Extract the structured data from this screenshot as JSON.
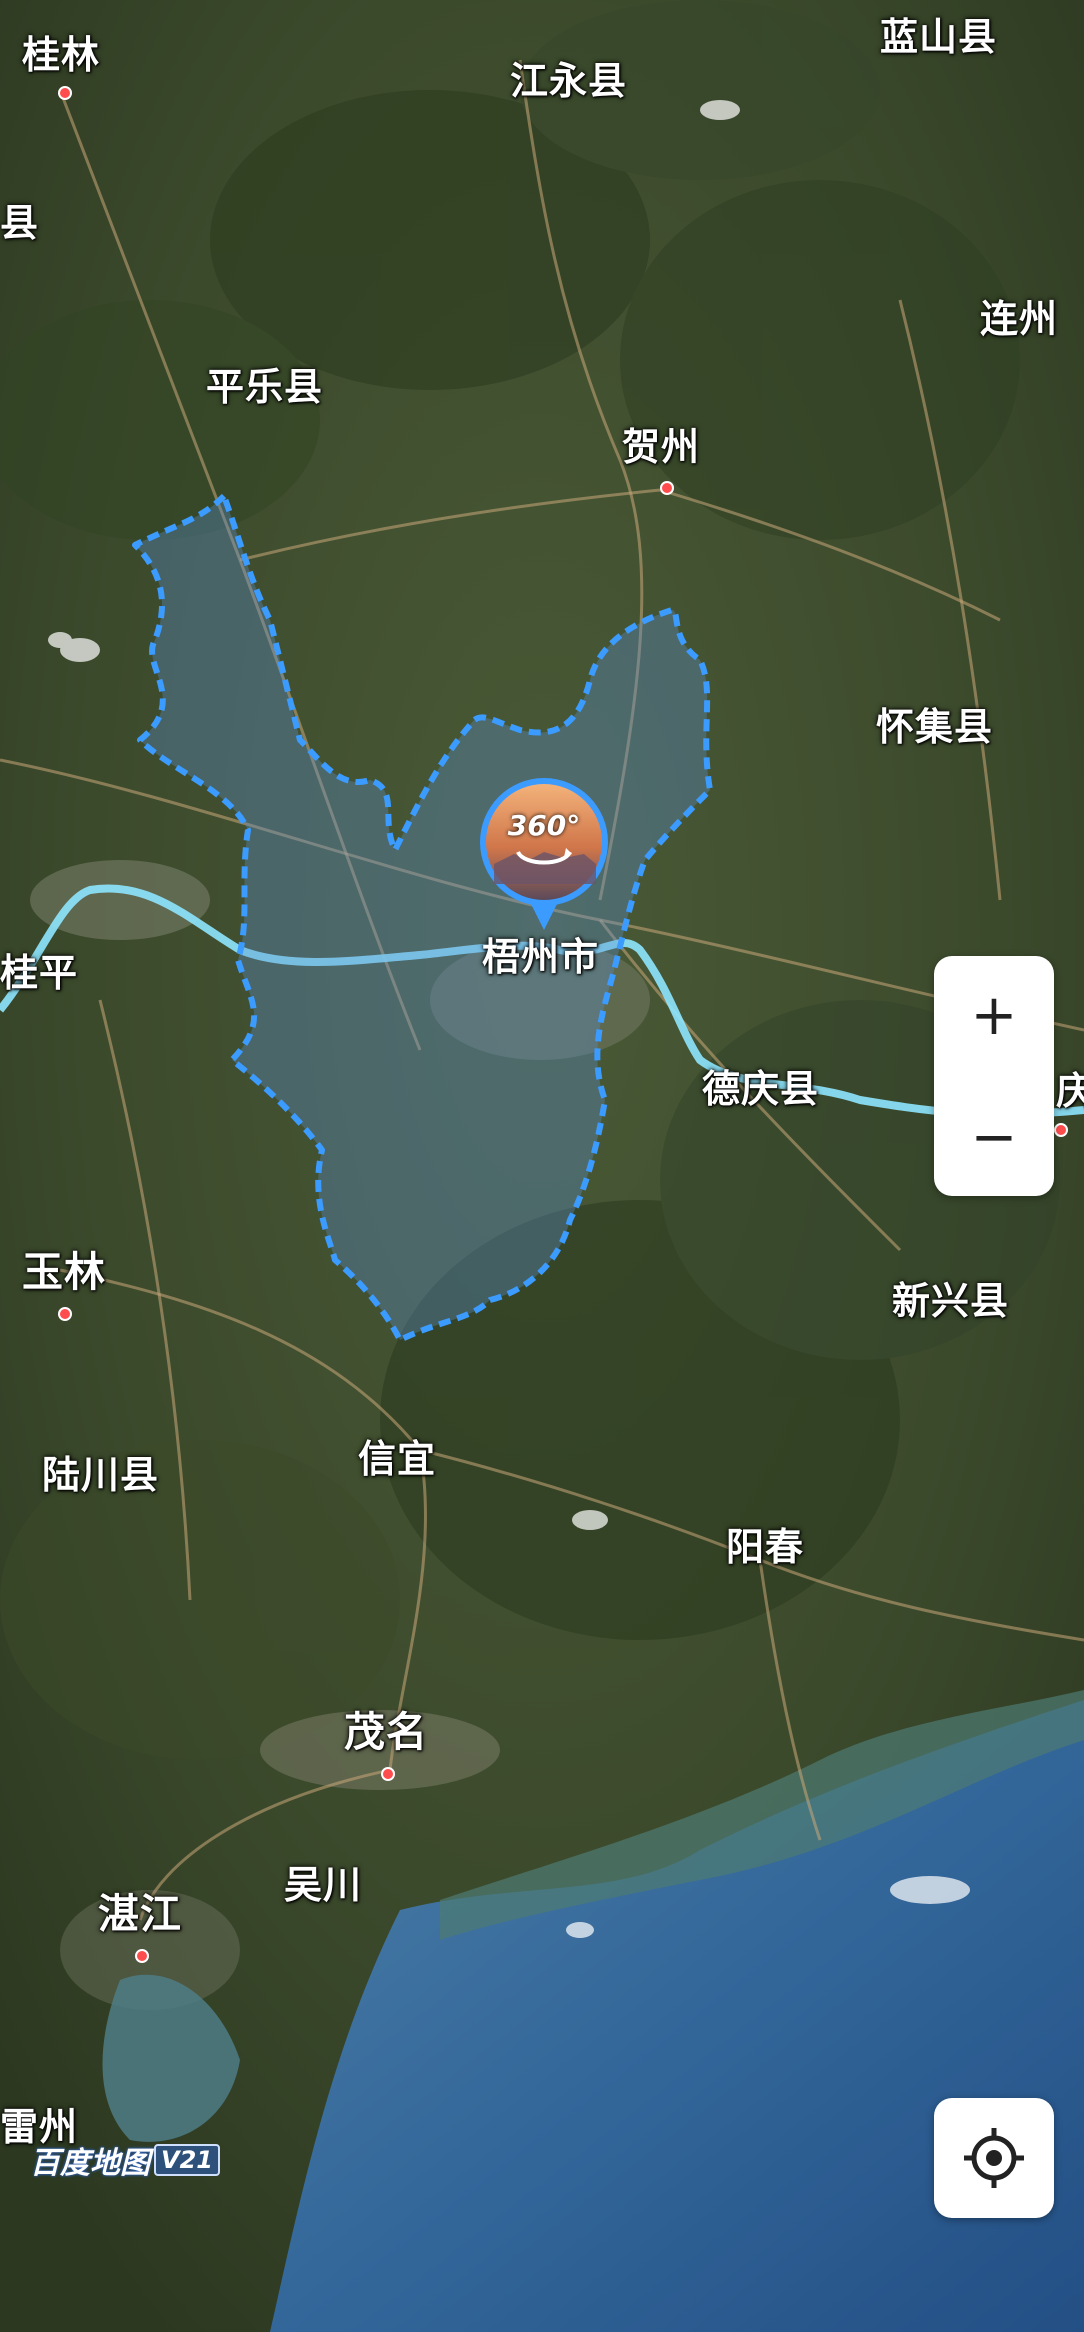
{
  "map": {
    "cities": [
      {
        "id": "guilin",
        "name": "桂林",
        "capital": true
      },
      {
        "id": "jiangyong",
        "name": "江永县",
        "capital": false
      },
      {
        "id": "lanshan",
        "name": "蓝山县",
        "capital": false
      },
      {
        "id": "xian-edge",
        "name": "县",
        "capital": false
      },
      {
        "id": "lianzhou",
        "name": "连州",
        "capital": false
      },
      {
        "id": "pingle",
        "name": "平乐县",
        "capital": false
      },
      {
        "id": "hezhou",
        "name": "贺州",
        "capital": true
      },
      {
        "id": "huaiji",
        "name": "怀集县",
        "capital": false
      },
      {
        "id": "wuzhou",
        "name": "梧州市",
        "capital": false,
        "highlighted": true
      },
      {
        "id": "guiping",
        "name": "桂平",
        "capital": false
      },
      {
        "id": "deqing",
        "name": "德庆县",
        "capital": false
      },
      {
        "id": "zhaoqing-edge",
        "name": "庆",
        "capital": true
      },
      {
        "id": "yulin",
        "name": "玉林",
        "capital": true
      },
      {
        "id": "xinxing",
        "name": "新兴县",
        "capital": false
      },
      {
        "id": "luchuan",
        "name": "陆川县",
        "capital": false
      },
      {
        "id": "xinyi",
        "name": "信宜",
        "capital": false
      },
      {
        "id": "yangchun",
        "name": "阳春",
        "capital": false
      },
      {
        "id": "maoming",
        "name": "茂名",
        "capital": true
      },
      {
        "id": "wuchuan",
        "name": "吴川",
        "capital": false
      },
      {
        "id": "zhanjiang",
        "name": "湛江",
        "capital": true
      },
      {
        "id": "leizhou",
        "name": "雷州",
        "capital": false
      }
    ],
    "highlight_region": "梧州市",
    "boundary_color": "#3b9bff",
    "river_color": "#8ee6ff",
    "panorama_label": "360°",
    "zoom_in_label": "+",
    "zoom_out_label": "−",
    "logo_text": "百度地图",
    "logo_version": "V21"
  }
}
